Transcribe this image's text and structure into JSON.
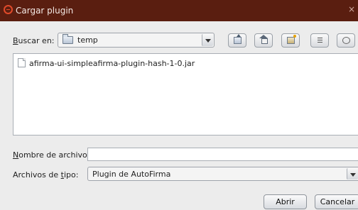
{
  "window": {
    "title": "Cargar plugin",
    "close_glyph": "×"
  },
  "toolbar": {
    "look_in_prefix": "B",
    "look_in_rest": "uscar en:",
    "location": "temp",
    "buttons": [
      {
        "name": "up-one-level-icon"
      },
      {
        "name": "home-icon"
      },
      {
        "name": "new-folder-icon"
      },
      {
        "name": "list-view-icon"
      },
      {
        "name": "details-view-icon"
      }
    ]
  },
  "files": [
    {
      "name": "afirma-ui-simpleafirma-plugin-hash-1-0.jar",
      "icon": "file-icon"
    }
  ],
  "form": {
    "filename_prefix": "N",
    "filename_rest": "ombre de archivo:",
    "filename_value": "",
    "filetype_a": "Archivos de ",
    "filetype_u": "t",
    "filetype_b": "ipo:",
    "filetype_value": "Plugin de AutoFirma"
  },
  "actions": {
    "open": "Abrir",
    "cancel": "Cancelar"
  }
}
